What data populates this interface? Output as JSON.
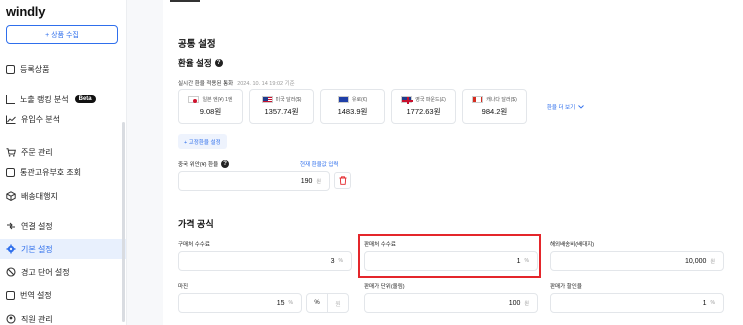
{
  "app": {
    "logo": "windly"
  },
  "sidebar": {
    "collect_button": "+ 상품 수집",
    "items": [
      {
        "label": "등록상품",
        "icon": "checkbox-icon"
      },
      {
        "label": "노출 랭킹 분석",
        "icon": "chart-icon",
        "badge": "Beta"
      },
      {
        "label": "유입수 분석",
        "icon": "trend-icon"
      },
      {
        "label": "주문 관리",
        "icon": "cart-icon"
      },
      {
        "label": "통관고유부호 조회",
        "icon": "id-card-icon"
      },
      {
        "label": "배송대행지",
        "icon": "box-icon"
      },
      {
        "label": "연결 설정",
        "icon": "link-icon"
      },
      {
        "label": "기본 설정",
        "icon": "gear-icon"
      },
      {
        "label": "경고 단어 설정",
        "icon": "block-icon"
      },
      {
        "label": "번역 설정",
        "icon": "document-icon"
      },
      {
        "label": "직원 관리",
        "icon": "users-icon"
      }
    ]
  },
  "main": {
    "section_title": "공통 설정",
    "exchange": {
      "title": "환율 설정",
      "subtitle": "실시간 환율 적용된 통화",
      "date": "2024. 10. 14 19:02 기준",
      "currencies": [
        {
          "label": "일본 엔(¥) 1엔",
          "value": "9.08원",
          "flag": "jp"
        },
        {
          "label": "미국 달러($)",
          "value": "1357.74원",
          "flag": "us"
        },
        {
          "label": "유로(€)",
          "value": "1483.9원",
          "flag": "eu"
        },
        {
          "label": "영국 파운드(£)",
          "value": "1772.63원",
          "flag": "gb"
        },
        {
          "label": "캐나다 달러($)",
          "value": "984.2원",
          "flag": "ca"
        }
      ],
      "more": "환율 더 보기",
      "fixed_button": "+ 고정환율 설정",
      "cny_label": "중국 위안(¥) 환율",
      "cny_link": "현재 환율값 입력",
      "cny_value": "190",
      "cny_unit": "원"
    },
    "price_formula": {
      "title": "가격 공식",
      "purchase_fee": {
        "label": "구매처 수수료",
        "value": "3",
        "unit": "%"
      },
      "sales_fee": {
        "label": "판매처 수수료",
        "value": "1",
        "unit": "%"
      },
      "overseas_shipping": {
        "label": "해외배송비(배대지)",
        "value": "10,000",
        "unit": "원"
      },
      "margin": {
        "label": "마진",
        "value": "15",
        "unit": "%",
        "toggle_pct": "%",
        "toggle_won": "원"
      },
      "price_unit": {
        "label": "판매가 단위(올림)",
        "value": "100",
        "unit": "원"
      },
      "discount": {
        "label": "판매가 할인율",
        "value": "1",
        "unit": "%"
      }
    }
  }
}
